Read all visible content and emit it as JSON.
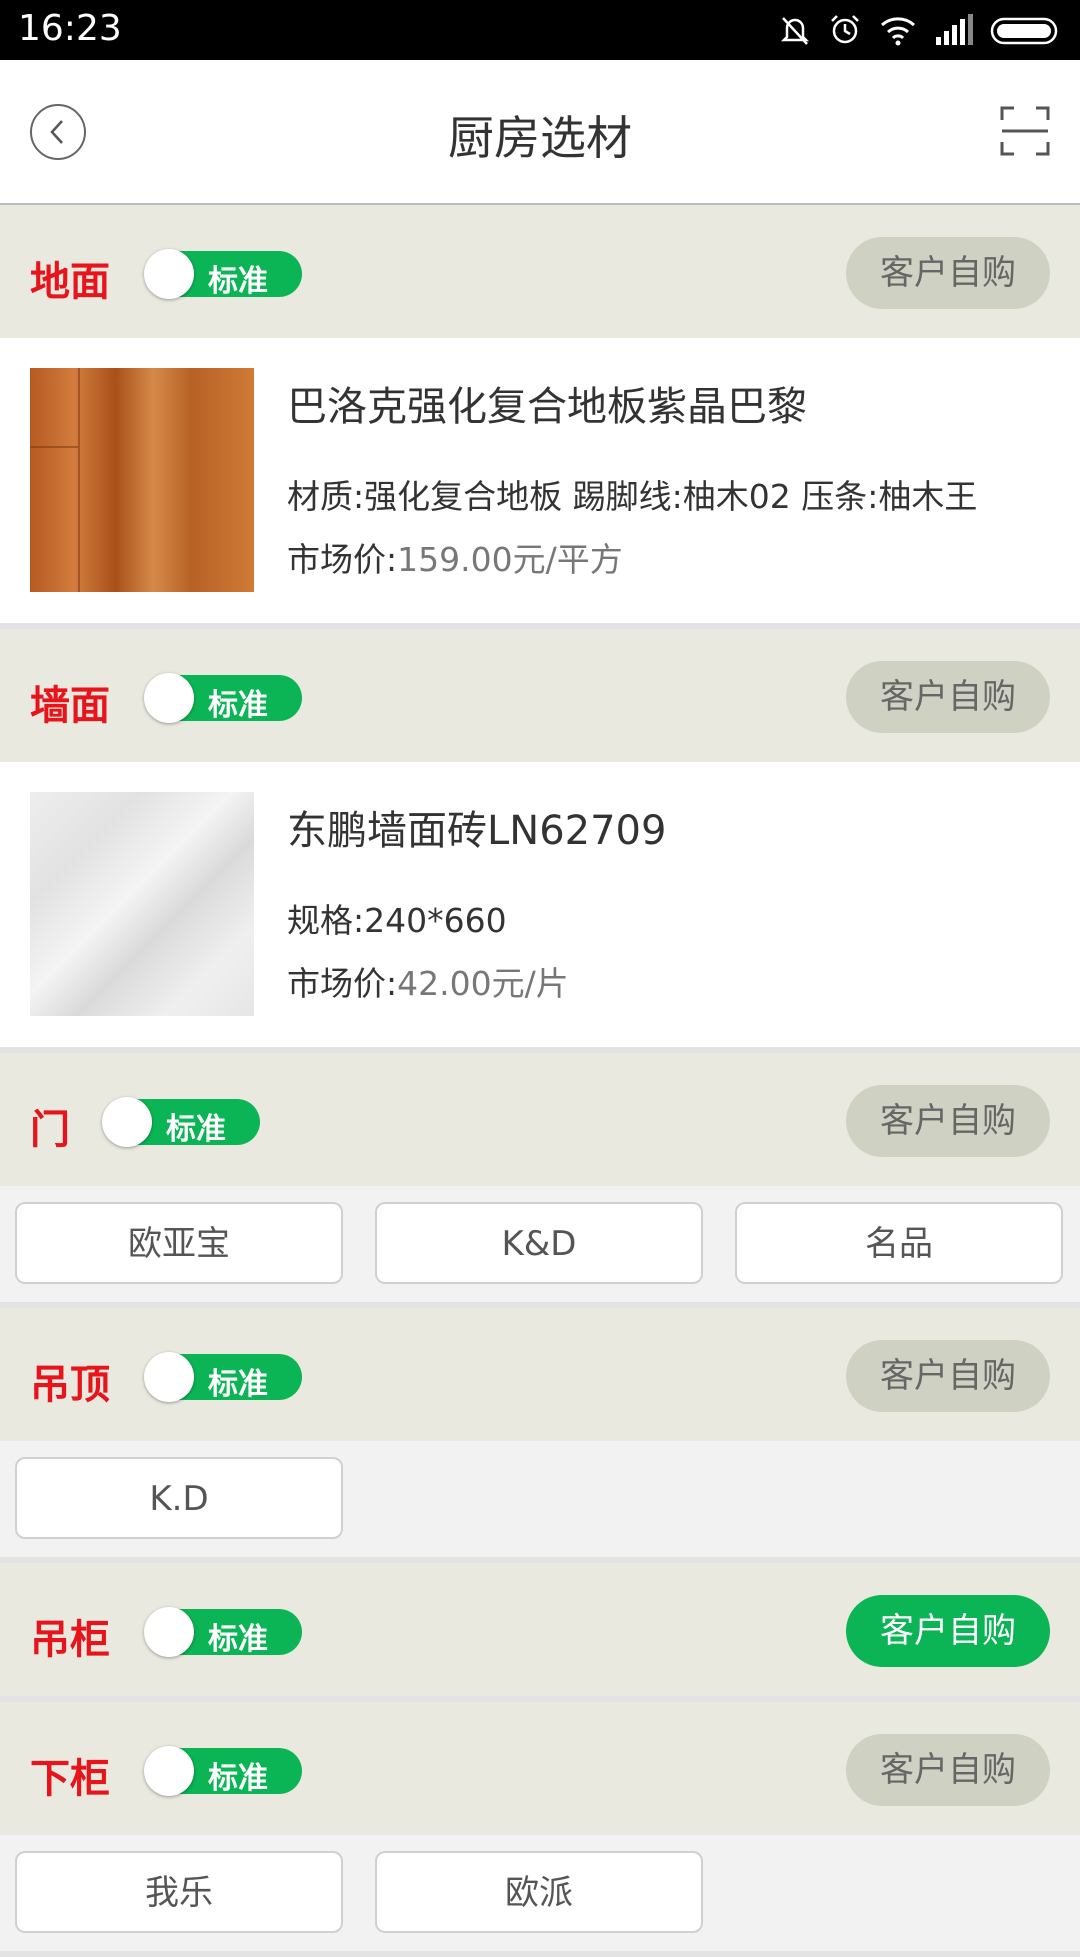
{
  "status_bar": {
    "time": "16:23"
  },
  "header": {
    "title": "厨房选材"
  },
  "sections": [
    {
      "title": "地面",
      "switch_label": "标准",
      "buy_label": "客户自购",
      "buy_active": false,
      "product": {
        "name": "巴洛克强化复合地板紫晶巴黎",
        "attrs": "材质:强化复合地板 踢脚线:柚木02 压条:柚木王",
        "price_label": "市场价:",
        "price_value": "159.00元/平方"
      }
    },
    {
      "title": "墙面",
      "switch_label": "标准",
      "buy_label": "客户自购",
      "buy_active": false,
      "product": {
        "name": "东鹏墙面砖LN62709",
        "attrs": "规格:240*660",
        "price_label": "市场价:",
        "price_value": "42.00元/片"
      }
    },
    {
      "title": "门",
      "switch_label": "标准",
      "buy_label": "客户自购",
      "buy_active": false,
      "brands": [
        "欧亚宝",
        "K&D",
        "名品"
      ]
    },
    {
      "title": "吊顶",
      "switch_label": "标准",
      "buy_label": "客户自购",
      "buy_active": false,
      "brands": [
        "K.D"
      ]
    },
    {
      "title": "吊柜",
      "switch_label": "标准",
      "buy_label": "客户自购",
      "buy_active": true
    },
    {
      "title": "下柜",
      "switch_label": "标准",
      "buy_label": "客户自购",
      "buy_active": false,
      "brands": [
        "我乐",
        "欧派"
      ]
    }
  ],
  "colors": {
    "accent_green": "#0bb454",
    "section_title_red": "#e8141b",
    "section_header_bg": "#e9e9e0"
  }
}
